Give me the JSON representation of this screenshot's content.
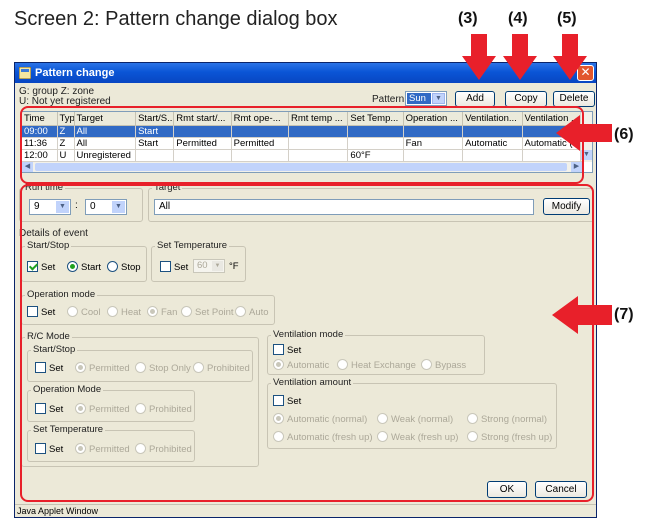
{
  "caption": "Screen 2: Pattern change dialog box",
  "callouts": {
    "c3": "(3)",
    "c4": "(4)",
    "c5": "(5)",
    "c6": "(6)",
    "c7": "(7)"
  },
  "colors": {
    "callout_red": "#e8202a",
    "title_blue": "#0a55d6",
    "selection": "#316ac5"
  },
  "window": {
    "title": "Pattern change",
    "legend_line1": "G: group Z: zone",
    "legend_line2": "U: Not yet registered",
    "pattern_label": "Pattern",
    "pattern_value": "Sun",
    "add_label": "Add",
    "copy_label": "Copy",
    "delete_label": "Delete"
  },
  "table": {
    "headers": [
      "Time",
      "Type",
      "Target",
      "Start/S...",
      "Rmt start/...",
      "Rmt ope-...",
      "Rmt temp ...",
      "Set Temp...",
      "Operation ...",
      "Ventilation...",
      "Ventilation ..."
    ],
    "rows": [
      [
        "09:00",
        "Z",
        "All",
        "Start",
        "",
        "",
        "",
        "",
        "",
        "",
        ""
      ],
      [
        "11:36",
        "Z",
        "All",
        "Start",
        "Permitted",
        "Permitted",
        "",
        "",
        "Fan",
        "Automatic",
        "Automatic (..."
      ],
      [
        "12:00",
        "U",
        "Unregistered",
        "",
        "",
        "",
        "",
        "60°F",
        "",
        "",
        ""
      ]
    ]
  },
  "runtime": {
    "label": "Run time",
    "hour": "9",
    "sep": ":",
    "minute": "0"
  },
  "target": {
    "label": "Target",
    "value": "All",
    "modify_label": "Modify"
  },
  "details": {
    "label": "Details of event",
    "startstop": {
      "label": "Start/Stop",
      "set": "Set",
      "start": "Start",
      "stop": "Stop"
    },
    "settemp": {
      "label": "Set Temperature",
      "set": "Set",
      "value": "60",
      "unit": "°F"
    },
    "opmode": {
      "label": "Operation mode",
      "set": "Set",
      "cool": "Cool",
      "heat": "Heat",
      "fan": "Fan",
      "setpoint": "Set Point",
      "auto": "Auto"
    },
    "rc": {
      "label": "R/C Mode",
      "startstop": {
        "label": "Start/Stop",
        "set": "Set",
        "permitted": "Permitted",
        "stoponly": "Stop Only",
        "prohibited": "Prohibited"
      },
      "opmode": {
        "label": "Operation Mode",
        "set": "Set",
        "permitted": "Permitted",
        "prohibited": "Prohibited"
      },
      "settemp": {
        "label": "Set Temperature",
        "set": "Set",
        "permitted": "Permitted",
        "prohibited": "Prohibited"
      }
    },
    "ventmode": {
      "label": "Ventilation mode",
      "set": "Set",
      "automatic": "Automatic",
      "heatex": "Heat Exchange",
      "bypass": "Bypass"
    },
    "ventamount": {
      "label": "Ventilation amount",
      "set": "Set",
      "auto_normal": "Automatic (normal)",
      "weak_normal": "Weak (normal)",
      "strong_normal": "Strong (normal)",
      "auto_fresh": "Automatic (fresh up)",
      "weak_fresh": "Weak (fresh up)",
      "strong_fresh": "Strong (fresh up)"
    }
  },
  "ok_label": "OK",
  "cancel_label": "Cancel",
  "statusbar": "Java Applet Window"
}
